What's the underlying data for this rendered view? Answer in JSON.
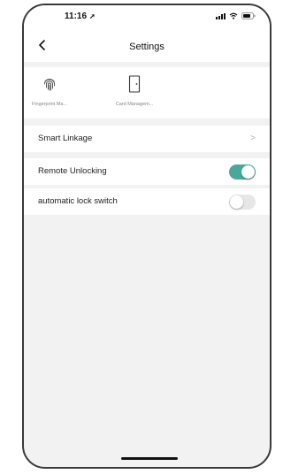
{
  "status_bar": {
    "time": "11:16",
    "location_icon": "location-arrow-icon",
    "signal_icon": "signal-icon",
    "wifi_icon": "wifi-icon",
    "battery_icon": "battery-icon"
  },
  "nav": {
    "back_icon": "chevron-left-icon",
    "title": "Settings"
  },
  "features": [
    {
      "label": "Fingerprint Ma...",
      "icon": "fingerprint-icon"
    },
    {
      "label": "Card Managem...",
      "icon": "door-icon"
    }
  ],
  "rows": {
    "smart_linkage": {
      "label": "Smart Linkage",
      "chevron": ">"
    },
    "remote_unlocking": {
      "label": "Remote Unlocking",
      "enabled": true
    },
    "automatic_lock": {
      "label": "automatic lock switch",
      "enabled": false
    }
  },
  "colors": {
    "toggle_on": "#4aa89a",
    "toggle_off": "#e6e6e6",
    "background": "#f2f2f2"
  }
}
